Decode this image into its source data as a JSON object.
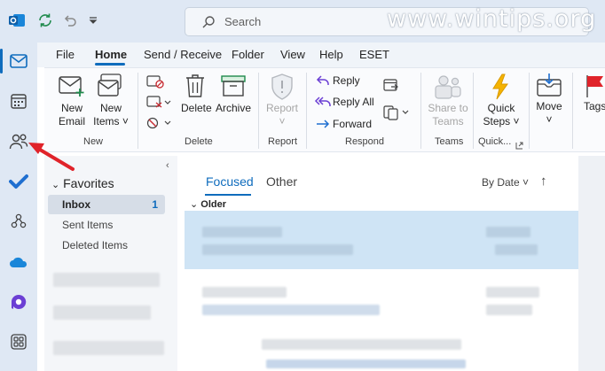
{
  "titlebar": {
    "search_placeholder": "Search",
    "watermark": "www.wintips.org",
    "icons": [
      "outlook-logo-icon",
      "sync-icon",
      "undo-icon",
      "customize-quick-access-icon"
    ]
  },
  "rail": {
    "items": [
      "mail-icon",
      "calendar-icon",
      "people-icon",
      "todo-icon",
      "apps-org-icon",
      "onedrive-icon",
      "viva-icon",
      "more-apps-icon"
    ]
  },
  "ribbon_tabs": [
    "File",
    "Home",
    "Send / Receive",
    "Folder",
    "View",
    "Help",
    "ESET"
  ],
  "ribbon": {
    "new_email": [
      "New",
      "Email"
    ],
    "new_items": [
      "New",
      "Items ˅"
    ],
    "group_new": "New",
    "delete": "Delete",
    "archive": "Archive",
    "group_delete": "Delete",
    "report": "Report",
    "group_report": "Report",
    "reply": "Reply",
    "reply_all": "Reply All",
    "forward": "Forward",
    "group_respond": "Respond",
    "share_to_teams": [
      "Share to",
      "Teams"
    ],
    "group_teams": "Teams",
    "quick_steps": [
      "Quick",
      "Steps ˅"
    ],
    "group_quick": "Quick...",
    "move": "Move",
    "tags": "Tags"
  },
  "folders": {
    "favorites_label": "Favorites",
    "items": [
      {
        "label": "Inbox",
        "count": "1"
      },
      {
        "label": "Sent Items",
        "count": ""
      },
      {
        "label": "Deleted Items",
        "count": ""
      }
    ]
  },
  "messages": {
    "tab_focused": "Focused",
    "tab_other": "Other",
    "sort_label": "By Date ˅",
    "sort_arrow": "↑",
    "group_header": "Older"
  },
  "colors": {
    "accent": "#0f6cbd",
    "selected_row": "#cfe4f5",
    "annotation_arrow": "#e0232a"
  }
}
